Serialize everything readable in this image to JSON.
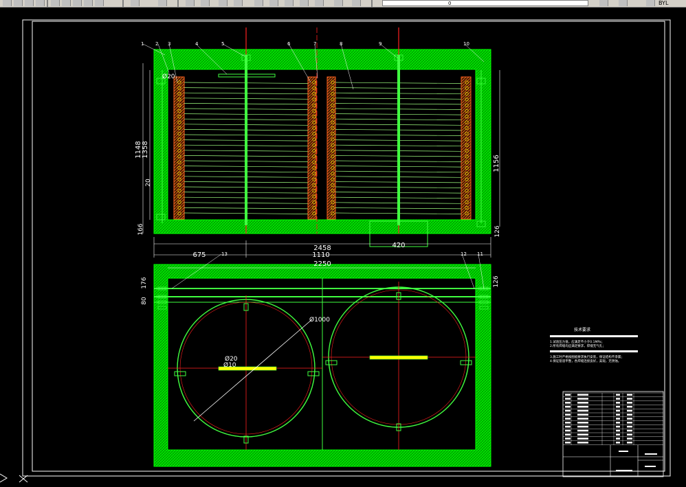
{
  "toolbar": {
    "layer_field_value": "0",
    "right_label": "BYL",
    "icons": [
      "new-icon",
      "open-icon",
      "save-icon",
      "print-icon",
      "cut-icon",
      "copy-icon",
      "paste-icon",
      "undo-icon",
      "redo-icon",
      "pan-icon",
      "zoom-icon",
      "zoom-window-icon",
      "zoom-previous-icon",
      "properties-icon",
      "text-style-icon",
      "layer-icon",
      "color-icon"
    ]
  },
  "drawing": {
    "elevation_view": {
      "dimensions": {
        "total_width": "2458",
        "left_segment": "675",
        "middle_segment": "1110",
        "right_opening": "420",
        "left_height_outer": "1148",
        "left_height_inner": "1358",
        "right_height": "1156",
        "left_small": "20",
        "left_bottom": "166",
        "right_bottom": "126",
        "pipe_dia": "Ø20"
      },
      "callouts": [
        "1",
        "2",
        "3",
        "4",
        "5",
        "6",
        "7",
        "8",
        "9",
        "10"
      ]
    },
    "plan_view": {
      "dimensions": {
        "total_width": "2250",
        "left_top": "176",
        "left_bottom": "80",
        "right_top": "126",
        "circle_dia": "Ø1000",
        "hole_dia_a": "Ø20",
        "hole_dia_b": "Ø10"
      },
      "callouts": [
        "13",
        "12",
        "11"
      ]
    },
    "notes": {
      "title": "技术要求",
      "lines": [
        "1.试验压力值，应满足不小于0.1MPa；",
        "2.所有焊缝均应满足要求，焊缝无气孔；",
        "3.施工时严格按图纸要求执行安装，保证结构不渗漏；",
        "4.保证管道平整，各焊缝连接良好，美观，无锈蚀。"
      ]
    },
    "title_block": {
      "part_rows": 13
    }
  },
  "colors": {
    "background": "#000000",
    "wall_hatch": "#00ff00",
    "centerline": "#ff2020",
    "white": "#ffffff",
    "coil_yellow": "#ffff00",
    "pipe_green": "#40ff40"
  }
}
